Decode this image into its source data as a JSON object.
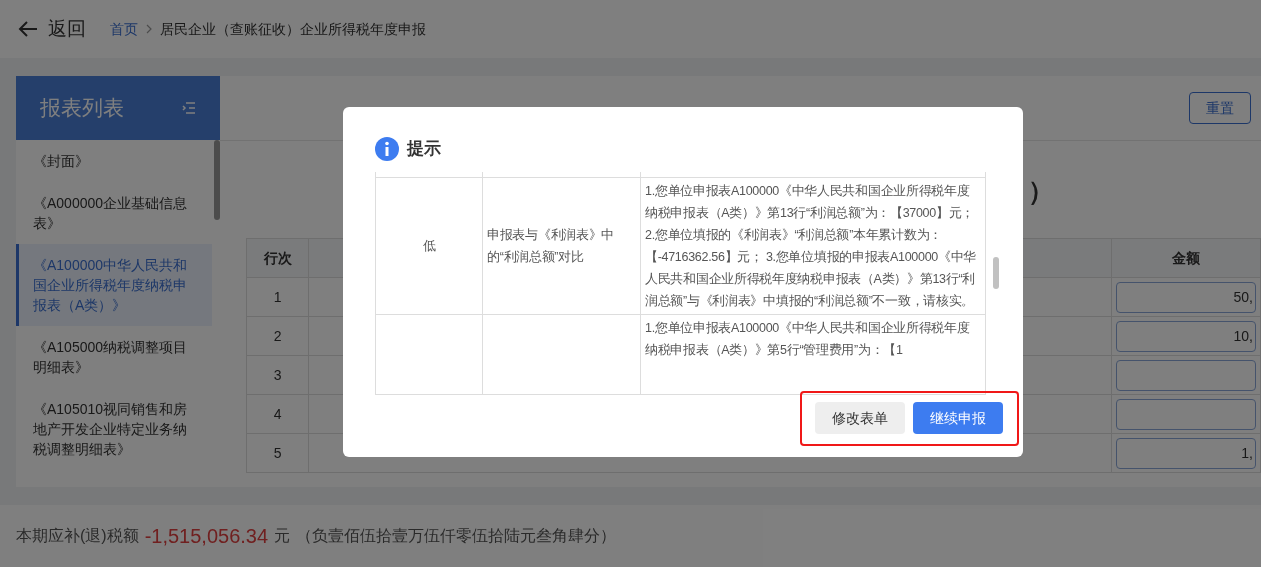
{
  "header": {
    "back_label": "返回",
    "breadcrumb": [
      "首页",
      "居民企业（查账征收）企业所得税年度申报"
    ]
  },
  "sidebar": {
    "title": "报表列表",
    "items": [
      {
        "label": "《封面》",
        "selected": false
      },
      {
        "label": "《A000000企业基础信息表》",
        "selected": false
      },
      {
        "label": "《A100000中华人民共和国企业所得税年度纳税申报表（A类）》",
        "selected": true
      },
      {
        "label": "《A105000纳税调整项目明细表》",
        "selected": false
      },
      {
        "label": "《A105010视同销售和房地产开发企业特定业务纳税调整明细表》",
        "selected": false
      }
    ]
  },
  "main": {
    "reset_button": "重置",
    "heading_visible": "）",
    "table": {
      "columns": [
        "行次",
        "金额"
      ],
      "rows": [
        {
          "row_no": "1",
          "amount": "50,"
        },
        {
          "row_no": "2",
          "amount": "10,"
        },
        {
          "row_no": "3",
          "amount": ""
        },
        {
          "row_no": "4",
          "amount": ""
        },
        {
          "row_no": "5",
          "amount": "1,"
        }
      ]
    }
  },
  "footer": {
    "label": "本期应补(退)税额",
    "amount": "-1,515,056.34",
    "unit": "元",
    "amount_in_words": "（负壹佰伍拾壹万伍仟零伍拾陆元叁角肆分）"
  },
  "dialog": {
    "title": "提示",
    "rows": [
      {
        "level": "",
        "item": "",
        "detail": ""
      },
      {
        "level": "低",
        "item": "申报表与《利润表》中的“利润总额”对比",
        "detail": "1.您单位申报表A100000《中华人民共和国企业所得税年度纳税申报表（A类）》第13行“利润总额”为：【37000】元； 2.您单位填报的《利润表》“利润总额”本年累计数为：【-4716362.56】元； 3.您单位填报的申报表A100000《中华人民共和国企业所得税年度纳税申报表（A类）》第13行“利润总额”与《利润表》中填报的“利润总额”不一致，请核实。"
      },
      {
        "level": "",
        "item": "",
        "detail": "1.您单位申报表A100000《中华人民共和国企业所得税年度纳税申报表（A类）》第5行“管理费用”为：【1"
      }
    ],
    "buttons": [
      {
        "label": "修改表单",
        "kind": "secondary"
      },
      {
        "label": "继续申报",
        "kind": "primary"
      }
    ]
  }
}
